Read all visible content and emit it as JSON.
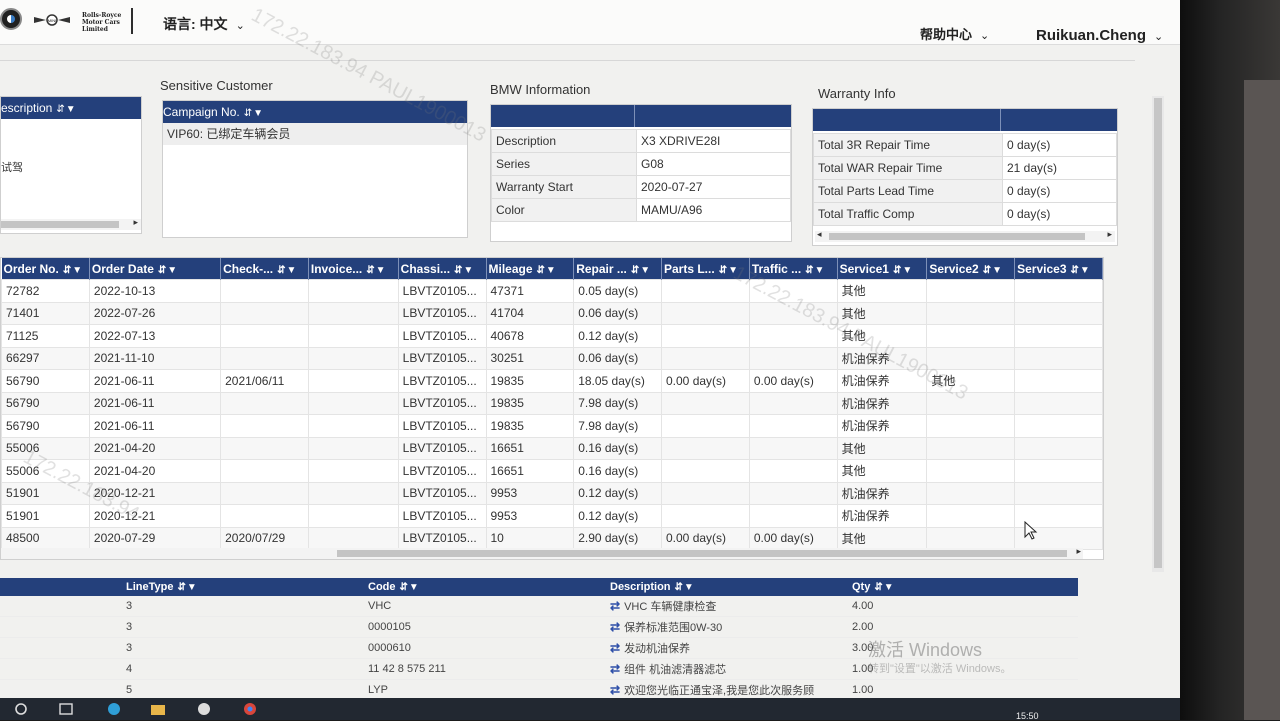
{
  "header": {
    "mini_logo": "MINI",
    "rr_logo": "Rolls-Royce Motor Cars Limited",
    "language_label": "语言: 中文",
    "help_label": "帮助中心",
    "user_name": "Ruikuan.Cheng"
  },
  "left_panel": {
    "header": "escription",
    "row_text": "试驾"
  },
  "sensitive": {
    "title": "Sensitive Customer",
    "header": "Campaign No.",
    "row": "VIP60: 已绑定车辆会员"
  },
  "bmw_info": {
    "title": "BMW Information",
    "rows": [
      {
        "label": "Description",
        "value": "X3 XDRIVE28I"
      },
      {
        "label": "Series",
        "value": "G08"
      },
      {
        "label": "Warranty Start",
        "value": "2020-07-27"
      },
      {
        "label": "Color",
        "value": "MAMU/A96"
      }
    ]
  },
  "warranty": {
    "title": "Warranty Info",
    "rows": [
      {
        "label": "Total 3R Repair Time",
        "value": "0 day(s)"
      },
      {
        "label": "Total WAR Repair Time",
        "value": "21 day(s)"
      },
      {
        "label": "Total Parts Lead Time",
        "value": "0 day(s)"
      },
      {
        "label": "Total Traffic Comp",
        "value": "0 day(s)"
      }
    ]
  },
  "orders": {
    "columns": [
      "Order No.",
      "Order Date",
      "Check-...",
      "Invoice...",
      "Chassi...",
      "Mileage",
      "Repair ...",
      "Parts L...",
      "Traffic ...",
      "Service1",
      "Service2",
      "Service3"
    ],
    "rows": [
      [
        "72782",
        "2022-10-13",
        "",
        "",
        "LBVTZ0105...",
        "47371",
        "0.05 day(s)",
        "",
        "",
        "其他",
        "",
        ""
      ],
      [
        "71401",
        "2022-07-26",
        "",
        "",
        "LBVTZ0105...",
        "41704",
        "0.06 day(s)",
        "",
        "",
        "其他",
        "",
        ""
      ],
      [
        "71125",
        "2022-07-13",
        "",
        "",
        "LBVTZ0105...",
        "40678",
        "0.12 day(s)",
        "",
        "",
        "其他",
        "",
        ""
      ],
      [
        "66297",
        "2021-11-10",
        "",
        "",
        "LBVTZ0105...",
        "30251",
        "0.06 day(s)",
        "",
        "",
        "机油保养",
        "",
        ""
      ],
      [
        "56790",
        "2021-06-11",
        "2021/06/11",
        "",
        "LBVTZ0105...",
        "19835",
        "18.05 day(s)",
        "0.00 day(s)",
        "0.00 day(s)",
        "机油保养",
        "其他",
        ""
      ],
      [
        "56790",
        "2021-06-11",
        "",
        "",
        "LBVTZ0105...",
        "19835",
        "7.98 day(s)",
        "",
        "",
        "机油保养",
        "",
        ""
      ],
      [
        "56790",
        "2021-06-11",
        "",
        "",
        "LBVTZ0105...",
        "19835",
        "7.98 day(s)",
        "",
        "",
        "机油保养",
        "",
        ""
      ],
      [
        "55006",
        "2021-04-20",
        "",
        "",
        "LBVTZ0105...",
        "16651",
        "0.16 day(s)",
        "",
        "",
        "其他",
        "",
        ""
      ],
      [
        "55006",
        "2021-04-20",
        "",
        "",
        "LBVTZ0105...",
        "16651",
        "0.16 day(s)",
        "",
        "",
        "其他",
        "",
        ""
      ],
      [
        "51901",
        "2020-12-21",
        "",
        "",
        "LBVTZ0105...",
        "9953",
        "0.12 day(s)",
        "",
        "",
        "机油保养",
        "",
        ""
      ],
      [
        "51901",
        "2020-12-21",
        "",
        "",
        "LBVTZ0105...",
        "9953",
        "0.12 day(s)",
        "",
        "",
        "机油保养",
        "",
        ""
      ],
      [
        "48500",
        "2020-07-29",
        "2020/07/29",
        "",
        "LBVTZ0105...",
        "10",
        "2.90 day(s)",
        "0.00 day(s)",
        "0.00 day(s)",
        "其他",
        "",
        ""
      ]
    ]
  },
  "lines": {
    "columns": [
      "LineType",
      "Code",
      "Description",
      "Qty"
    ],
    "rows": [
      [
        "3",
        "VHC",
        "VHC 车辆健康检查",
        "4.00"
      ],
      [
        "3",
        "0000105",
        "保养标准范围0W-30",
        "2.00"
      ],
      [
        "3",
        "0000610",
        "发动机油保养",
        "3.00"
      ],
      [
        "4",
        "11 42 8 575 211",
        "组件 机油滤清器滤芯",
        "1.00"
      ],
      [
        "5",
        "LYP",
        "欢迎您光临正通宝泽,我是您此次服务顾",
        "1.00"
      ]
    ]
  },
  "watermark": {
    "ip": "172.22.183.94",
    "text1": "172.22.183.94 PAUL1900013",
    "text2": "172.22.183.94 PAUL1900013"
  },
  "windows": {
    "activate_title": "激活 Windows",
    "activate_sub": "转到\"设置\"以激活 Windows。",
    "clock": "15:50"
  },
  "colors": {
    "header_blue": "#24407b"
  }
}
